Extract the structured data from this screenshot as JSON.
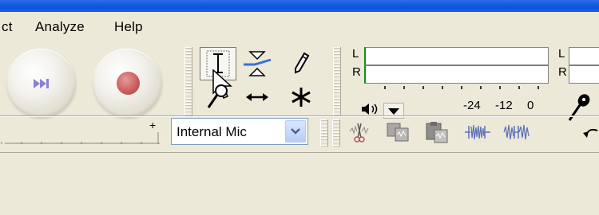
{
  "menu": {
    "items": [
      {
        "label": "ct"
      },
      {
        "label": "Analyze"
      },
      {
        "label": "Help"
      }
    ]
  },
  "control_toolbar": {
    "buttons": [
      {
        "name": "skip-to-end-button",
        "icon": "skip-end-icon",
        "color": "#8a80d6"
      },
      {
        "name": "record-button",
        "icon": "record-icon",
        "color": "#c95a5a"
      }
    ]
  },
  "tools_toolbar": {
    "tools": [
      {
        "name": "selection-tool",
        "icon": "i-beam-icon",
        "active": true
      },
      {
        "name": "envelope-tool",
        "icon": "envelope-icon",
        "active": false
      },
      {
        "name": "draw-tool",
        "icon": "pencil-icon",
        "active": false
      },
      {
        "name": "zoom-tool",
        "icon": "magnifier-icon",
        "active": false
      },
      {
        "name": "time-shift-tool",
        "icon": "double-arrow-icon",
        "active": false
      },
      {
        "name": "multi-tool",
        "icon": "asterisk-icon",
        "active": false
      }
    ]
  },
  "meter_toolbar": {
    "left_meter": {
      "playback_label": "L",
      "record_label": "R"
    },
    "right_meter": {
      "playback_label": "L",
      "record_label": "R"
    },
    "scale_labels": [
      "-24",
      "-12",
      "0"
    ],
    "meter_color": "#1a8a1a"
  },
  "mixer_toolbar": {
    "input_source": "Internal Mic"
  },
  "edit_toolbar": {
    "buttons": [
      {
        "name": "trim-button",
        "icon": "trim-icon"
      },
      {
        "name": "copy-button",
        "icon": "copy-icon"
      },
      {
        "name": "paste-button",
        "icon": "paste-icon"
      },
      {
        "name": "silence-button",
        "icon": "silence-icon"
      },
      {
        "name": "split-button",
        "icon": "split-icon"
      },
      {
        "name": "undo-button",
        "icon": "undo-icon"
      }
    ]
  },
  "colors": {
    "title_bar": "#0a52dc",
    "chrome": "#ece9d8",
    "record_red": "#c95a5a",
    "skip_purple": "#8a80d6",
    "dropdown_blue": "#b9cdf8"
  }
}
